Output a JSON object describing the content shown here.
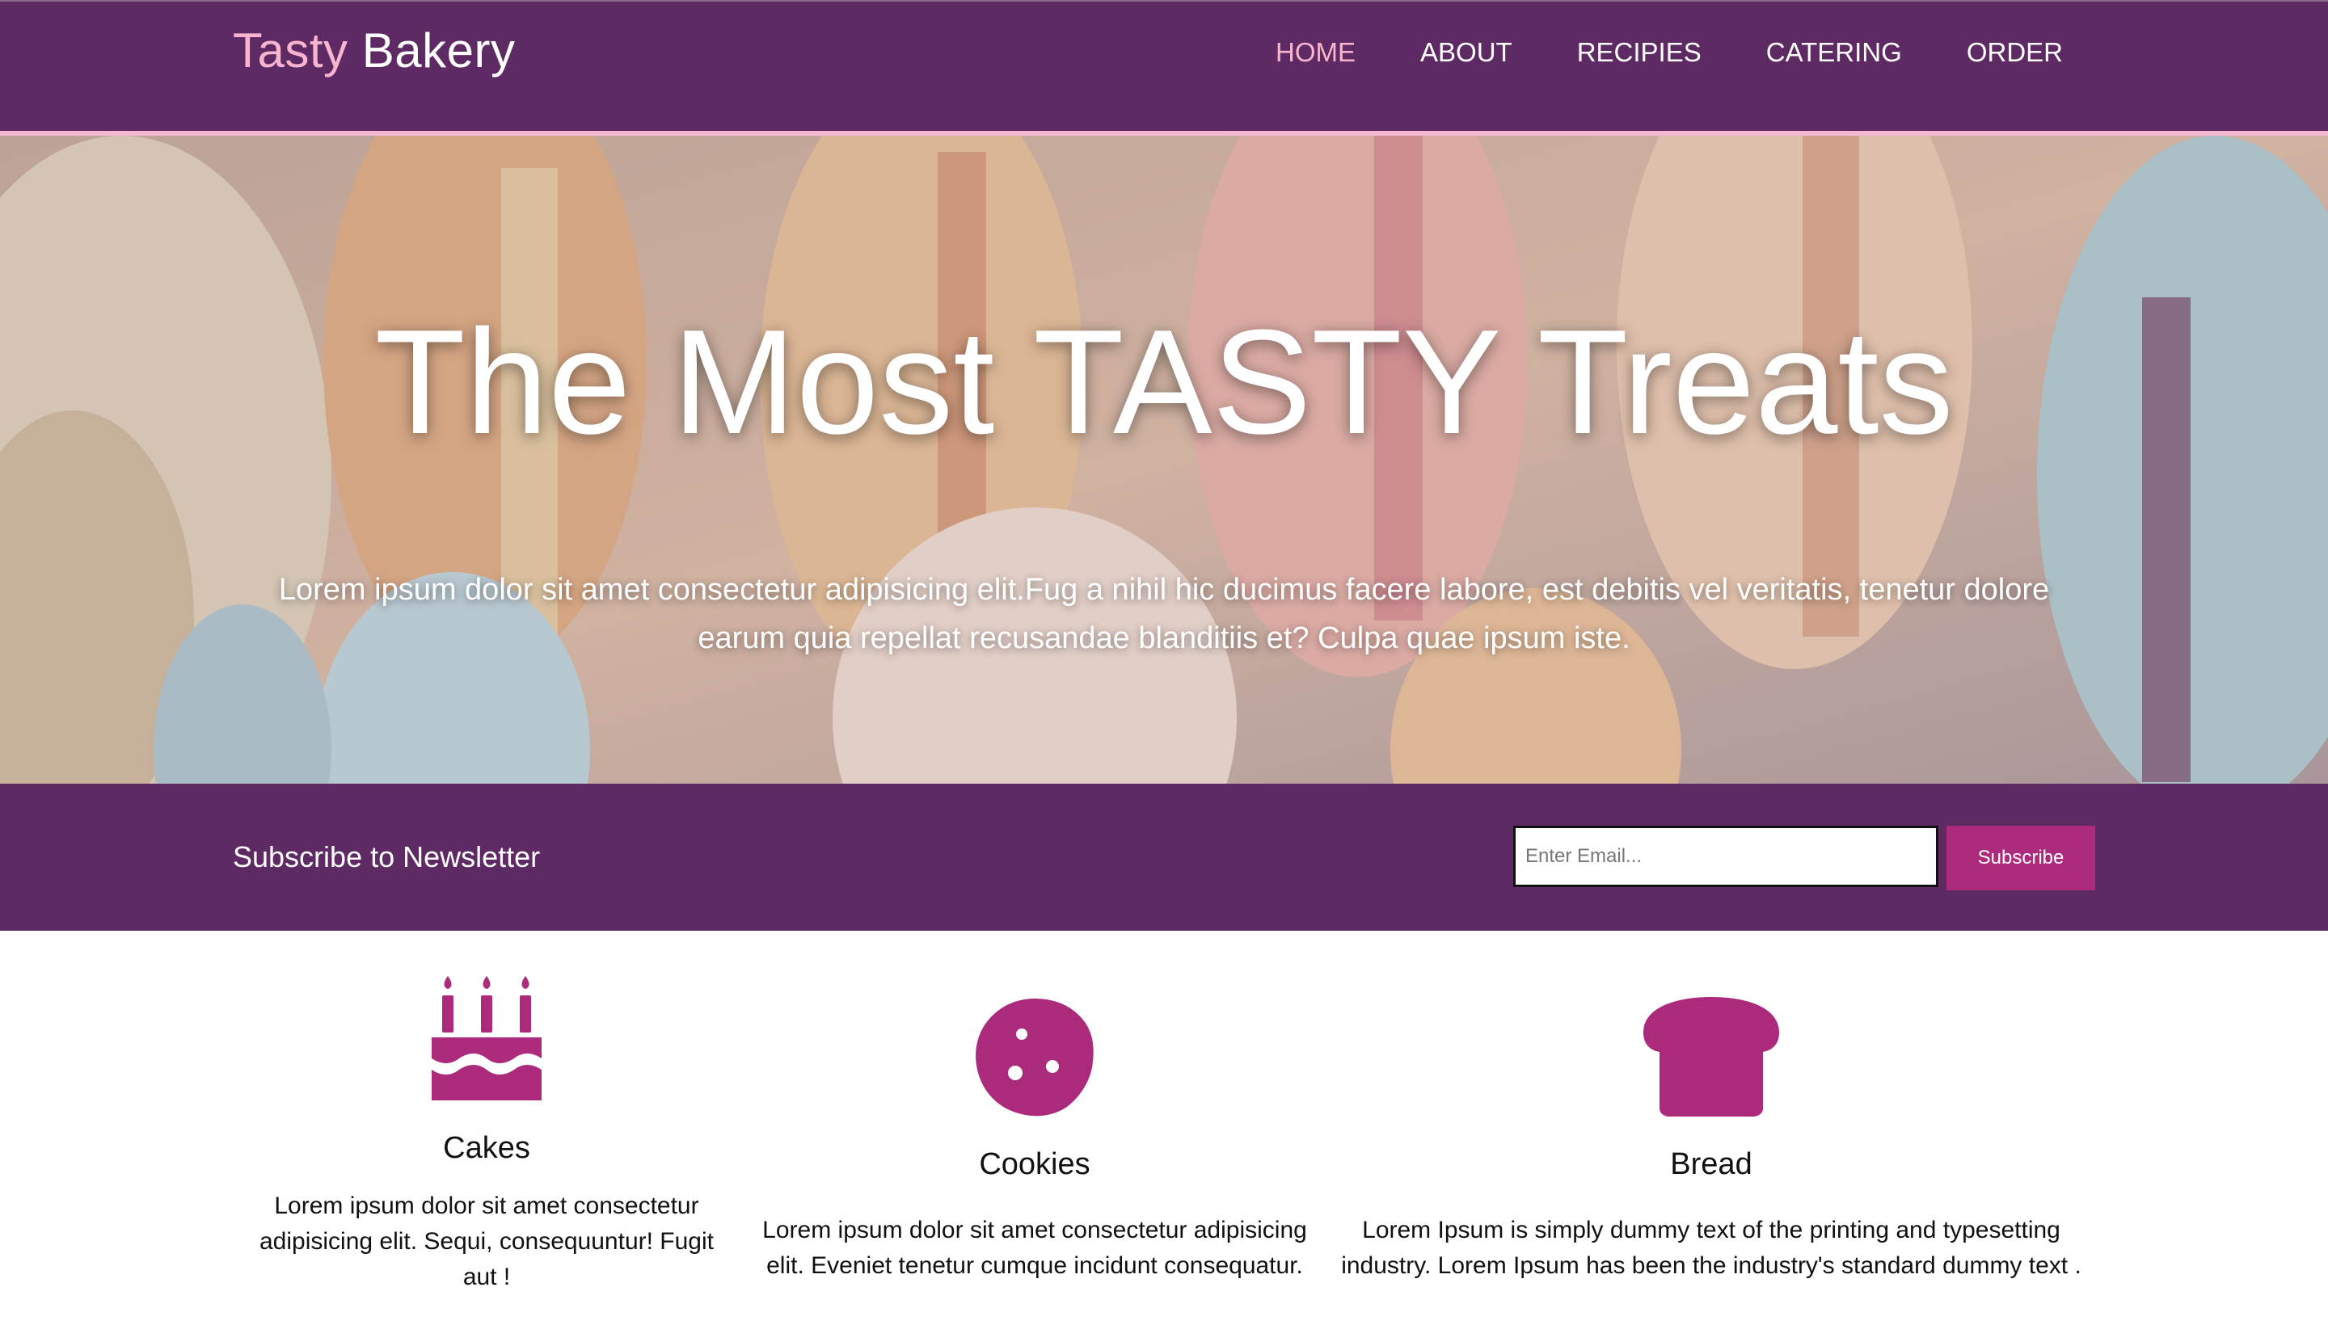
{
  "header": {
    "logo_part1": "Tasty",
    "logo_part2": "Bakery",
    "nav": [
      "HOME",
      "ABOUT",
      "RECIPIES",
      "CATERING",
      "ORDER"
    ],
    "active_nav": "HOME"
  },
  "hero": {
    "title": "The Most TASTY Treats",
    "text": "Lorem ipsum dolor sit amet consectetur adipisicing elit.Fug a nihil hic ducimus facere labore, est debitis vel veritatis, tenetur dolore earum quia repellat recusandae blanditiis et? Culpa quae ipsum iste."
  },
  "newsletter": {
    "label": "Subscribe to Newsletter",
    "email_placeholder": "Enter Email...",
    "email_value": "",
    "button_label": "Subscribe"
  },
  "features": [
    {
      "icon": "birthday-cake-icon",
      "title": "Cakes",
      "text": "Lorem ipsum dolor sit amet consectetur adipisicing elit. Sequi, consequuntur! Fugit aut !"
    },
    {
      "icon": "cookie-icon",
      "title": "Cookies",
      "text": "Lorem ipsum dolor sit amet consectetur adipisicing elit. Eveniet tenetur cumque incidunt consequatur."
    },
    {
      "icon": "bread-icon",
      "title": "Bread",
      "text": "Lorem Ipsum is simply dummy text of the printing and typesetting industry. Lorem Ipsum has been the industry's standard dummy text ."
    }
  ],
  "colors": {
    "header_bg": "#5e2a63",
    "accent_pink": "#f7b5d0",
    "icon_magenta": "#ac2a7b",
    "button_bg": "#ac2a7b"
  }
}
